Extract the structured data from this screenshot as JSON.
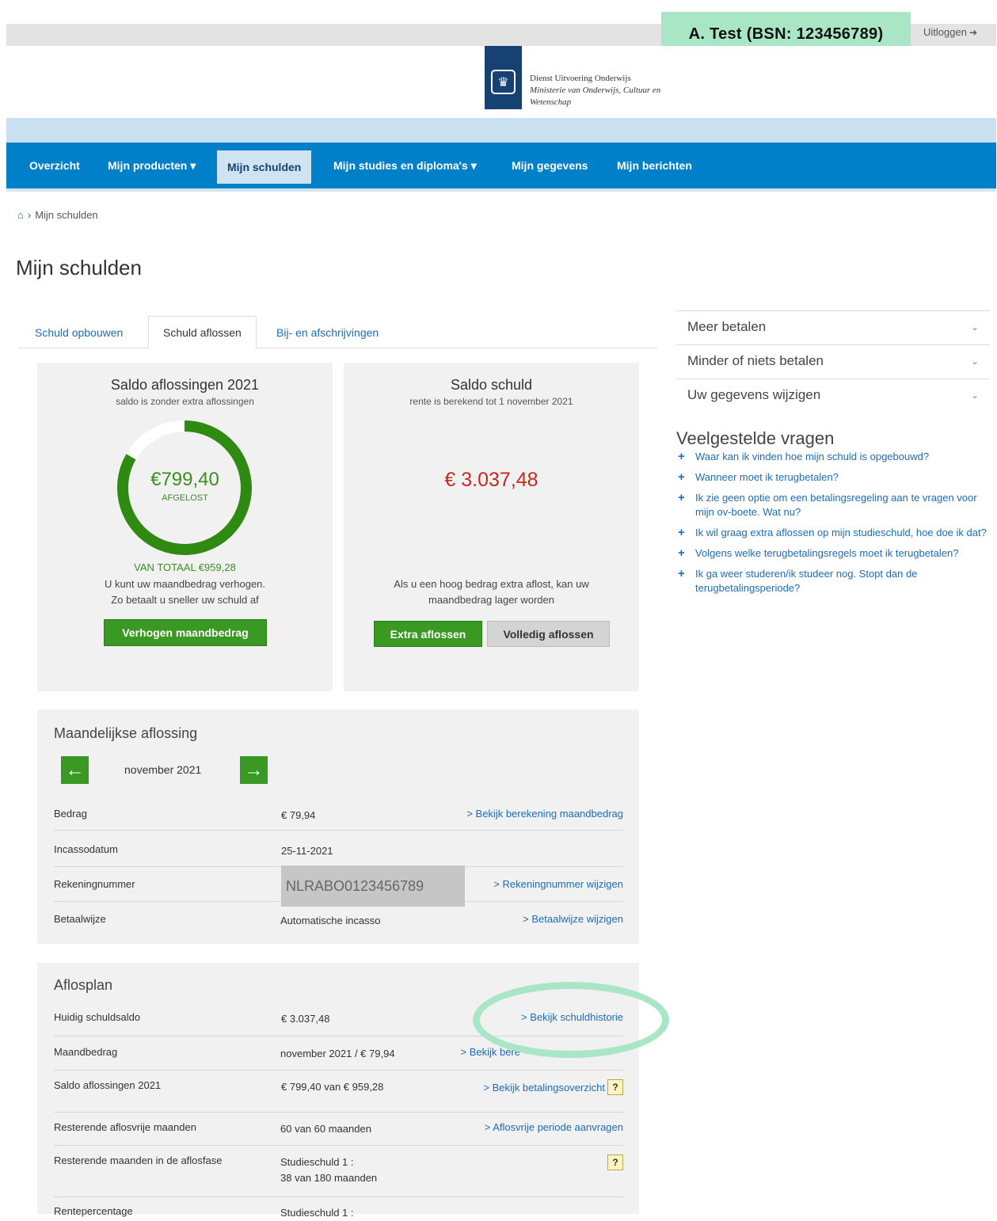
{
  "header": {
    "user": "A. Test (BSN: 123456789)",
    "logout": "Uitloggen",
    "org_name_line1": "Dienst Uitvoering Onderwijs",
    "org_name_line2": "Ministerie van Onderwijs, Cultuur en",
    "org_name_line3": "Wetenschap",
    "highlight_color": "#a8e6c6"
  },
  "nav": {
    "items": [
      {
        "label": "Overzicht"
      },
      {
        "label": "Mijn producten ▾"
      },
      {
        "label": "Mijn schulden",
        "active": true
      },
      {
        "label": "Mijn studies en diploma's ▾"
      },
      {
        "label": "Mijn gegevens"
      },
      {
        "label": "Mijn berichten"
      }
    ]
  },
  "breadcrumb": {
    "current": "Mijn schulden"
  },
  "page": {
    "title": "Mijn schulden"
  },
  "tabs": [
    {
      "label": "Schuld opbouwen"
    },
    {
      "label": "Schuld aflossen",
      "active": true
    },
    {
      "label": "Bij- en afschrijvingen"
    }
  ],
  "repayment_card": {
    "title": "Saldo aflossingen 2021",
    "subtitle": "saldo is zonder extra aflossingen",
    "amount": "€799,40",
    "amount_label": "AFGELOST",
    "paid_value": 799.4,
    "total_value": 959.28,
    "total_text": "VAN TOTAAL €959,28",
    "message_line1": "U kunt uw maandbedrag verhogen.",
    "message_line2": "Zo betaalt u sneller uw schuld af",
    "button": "Verhogen maandbedrag"
  },
  "debt_card": {
    "title": "Saldo schuld",
    "subtitle": "rente is berekend tot 1 november 2021",
    "amount": "€ 3.037,48",
    "message_line1": "Als u een hoog bedrag extra aflost, kan uw",
    "message_line2": "maandbedrag lager worden",
    "button_extra": "Extra aflossen",
    "button_full": "Volledig aflossen"
  },
  "monthly": {
    "title": "Maandelijkse aflossing",
    "month": "november 2021",
    "rows": [
      {
        "label": "Bedrag",
        "value": "€ 79,94",
        "link": "> Bekijk berekening maandbedrag"
      },
      {
        "label": "Incassodatum",
        "value": "25-11-2021",
        "link": ""
      },
      {
        "label": "Rekeningnummer",
        "value": "NLRABO0123456789",
        "link": "> Rekeningnummer wijzigen"
      },
      {
        "label": "Betaalwijze",
        "value": "Automatische incasso",
        "link": "> Betaalwijze wijzigen"
      }
    ]
  },
  "plan": {
    "title": "Aflosplan",
    "rows": [
      {
        "label": "Huidig schuldsaldo",
        "value": "€ 3.037,48",
        "link": "> Bekijk schuldhistorie"
      },
      {
        "label": "Maandbedrag",
        "value": "november 2021 / € 79,94",
        "link": "> Bekijk bere"
      },
      {
        "label": "Saldo aflossingen 2021",
        "value": "€ 799,40 van € 959,28",
        "link": "> Bekijk betalingsoverzicht"
      },
      {
        "label": "Resterende aflosvrije maanden",
        "value": "60 van 60 maanden",
        "link": "> Aflosvrije periode aanvragen"
      },
      {
        "label": "Resterende maanden in de aflosfase",
        "value_line1": "Studieschuld 1 :",
        "value_line2": "38 van 180 maanden",
        "link": ""
      },
      {
        "label": "Rentepercentage",
        "value": "Studieschuld 1 :",
        "link": ""
      }
    ],
    "help_glyph": "?"
  },
  "sidebar": {
    "accordions": [
      {
        "label": "Meer betalen"
      },
      {
        "label": "Minder of niets betalen"
      },
      {
        "label": "Uw gegevens wijzigen"
      }
    ],
    "faq_title": "Veelgestelde vragen",
    "faq": [
      "Waar kan ik vinden hoe mijn schuld is opgebouwd?",
      "Wanneer moet ik terugbetalen?",
      "Ik zie geen optie om een betalingsregeling aan te vragen voor mijn ov-boete. Wat nu?",
      "Ik wil graag extra aflossen op mijn studieschuld, hoe doe ik dat?",
      "Volgens welke terugbetalingsregels moet ik terugbetalen?",
      "Ik ga weer studeren/ik studeer nog. Stopt dan de terugbetalingsperiode?"
    ]
  }
}
